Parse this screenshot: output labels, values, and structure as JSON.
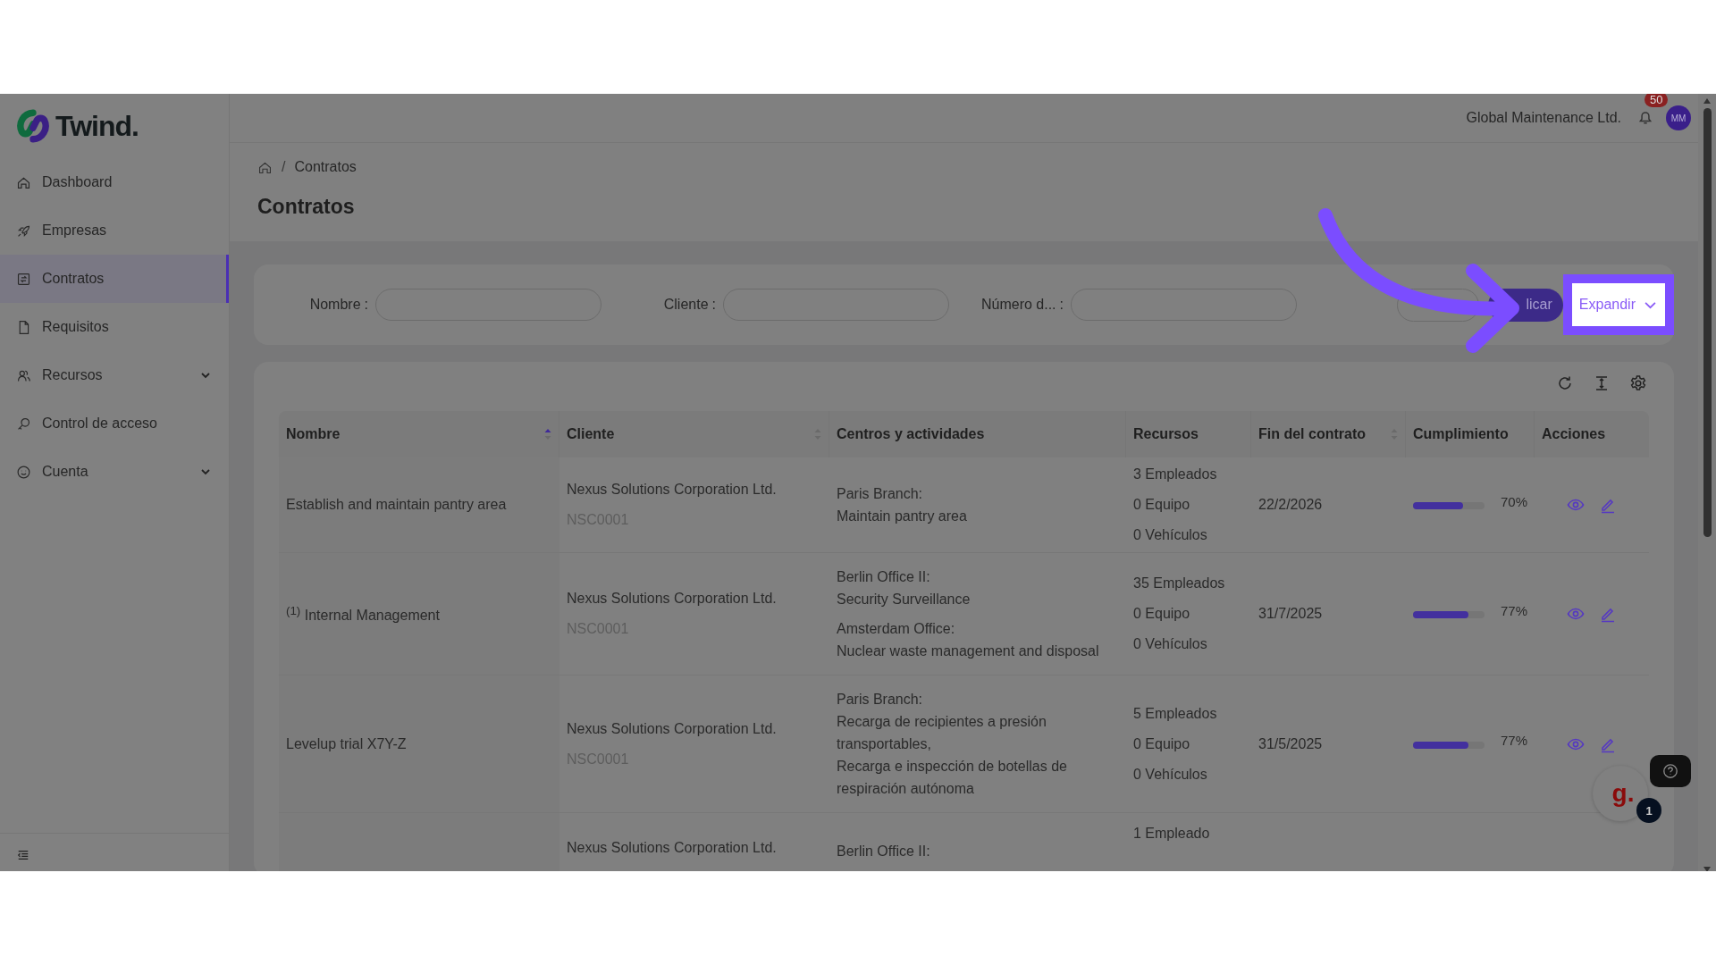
{
  "brand": {
    "name": "Twind."
  },
  "sidebar": {
    "items": [
      {
        "label": "Dashboard",
        "kind": "home",
        "selected": false
      },
      {
        "label": "Empresas",
        "kind": "rocket",
        "selected": false
      },
      {
        "label": "Contratos",
        "kind": "contract",
        "selected": true
      },
      {
        "label": "Requisitos",
        "kind": "file",
        "selected": false
      },
      {
        "label": "Recursos",
        "kind": "people",
        "selected": false,
        "expanded": false
      },
      {
        "label": "Control de acceso",
        "kind": "key",
        "selected": false
      },
      {
        "label": "Cuenta",
        "kind": "smile",
        "selected": false,
        "expanded": false
      }
    ]
  },
  "header": {
    "company": "Global Maintenance Ltd.",
    "notifications": "50",
    "avatar": "MM"
  },
  "breadcrumb": {
    "separator": "/",
    "items": [
      "Contratos"
    ]
  },
  "title": "Contratos",
  "filters": [
    {
      "label": "Nombre",
      "colon": ":"
    },
    {
      "label": "Cliente",
      "colon": ":"
    },
    {
      "label": "Número d...",
      "colon": ":"
    }
  ],
  "filter_buttons": [
    {
      "kind": "outline"
    },
    {
      "kind": "primary",
      "label": "licar"
    },
    {
      "kind": "expand",
      "label": "Expandir",
      "highlighted": true
    }
  ],
  "table": {
    "columns": [
      {
        "label": "Nombre",
        "sorted": true
      },
      {
        "label": "Cliente",
        "sorted": false
      },
      {
        "label": "Centros y actividades"
      },
      {
        "label": "Recursos"
      },
      {
        "label": "Fin del contrato",
        "sorted": false
      },
      {
        "label": "Cumplimiento"
      },
      {
        "label": "Acciones"
      }
    ],
    "rows": [
      {
        "name": "Establish and maintain pantry area",
        "client": "Nexus Solutions Corporation Ltd.",
        "code": "NSC0001",
        "centers": [
          {
            "site": "Paris Branch:",
            "activities": [
              "Maintain pantry area"
            ]
          }
        ],
        "resources": [
          "3 Empleados",
          "0 Equipo",
          "0 Vehículos"
        ],
        "end": "22/2/2026",
        "level": 0.7,
        "percent": "70%"
      },
      {
        "name": "$^{(1)}$ Internal Management",
        "client": "Nexus Solutions Corporation Ltd.",
        "code": "NSC0001",
        "centers": [
          {
            "site": "Berlin Office II:",
            "activities": [
              "Security Surveillance"
            ]
          },
          {
            "site": "Amsterdam Office:",
            "activities": [
              "Nuclear waste management and disposal"
            ]
          }
        ],
        "resources": [
          "35 Empleados",
          "0 Equipo",
          "0 Vehículos"
        ],
        "end": "31/7/2025",
        "level": 0.77,
        "percent": "77%"
      },
      {
        "name": "Levelup trial X7Y-Z",
        "client": "Nexus Solutions Corporation Ltd.",
        "code": "NSC0001",
        "centers": [
          {
            "site": "Paris Branch:",
            "activities": [
              "Recarga de recipientes a presión transportables,",
              "Recarga e inspección de botellas de respiración autónoma"
            ]
          }
        ],
        "resources": [
          "5 Empleados",
          "0 Equipo",
          "0 Vehículos"
        ],
        "end": "31/5/2025",
        "level": 0.77,
        "percent": "77%"
      },
      {
        "client": "Nexus Solutions Corporation Ltd.",
        "centers": [
          {
            "site": "Berlin Office II:"
          }
        ],
        "resources": [
          "1 Empleado"
        ]
      }
    ]
  },
  "help": {
    "logo": "g.",
    "badge": "1"
  }
}
